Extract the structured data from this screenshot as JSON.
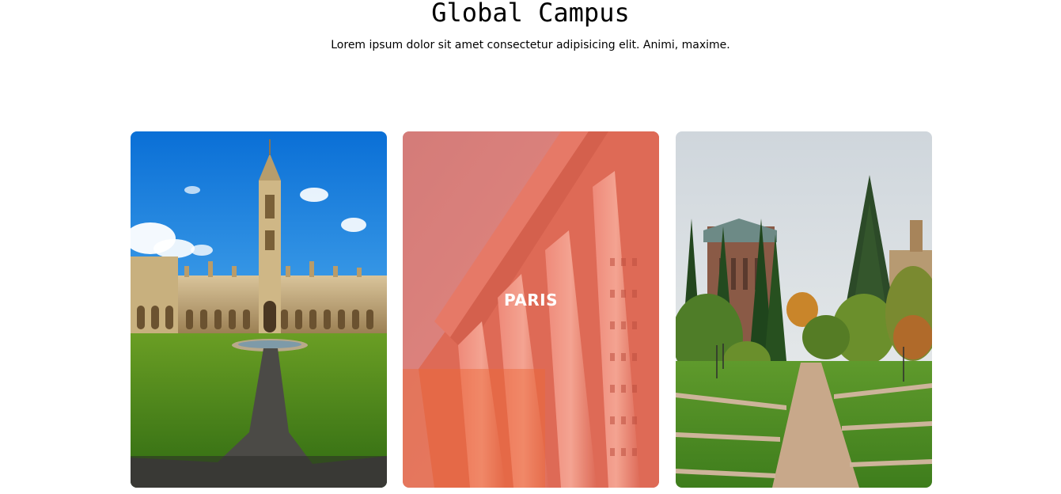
{
  "header": {
    "title": "Global Campus",
    "subtitle": "Lorem ipsum dolor sit amet consectetur adipisicing elit. Animi, maxime."
  },
  "cards": [
    {
      "image": "gothic-college-quad-photo",
      "label": ""
    },
    {
      "image": "classical-columns-building-photo",
      "label": "PARIS",
      "overlay_color": "#e8604a"
    },
    {
      "image": "university-park-walkway-photo",
      "label": ""
    }
  ]
}
